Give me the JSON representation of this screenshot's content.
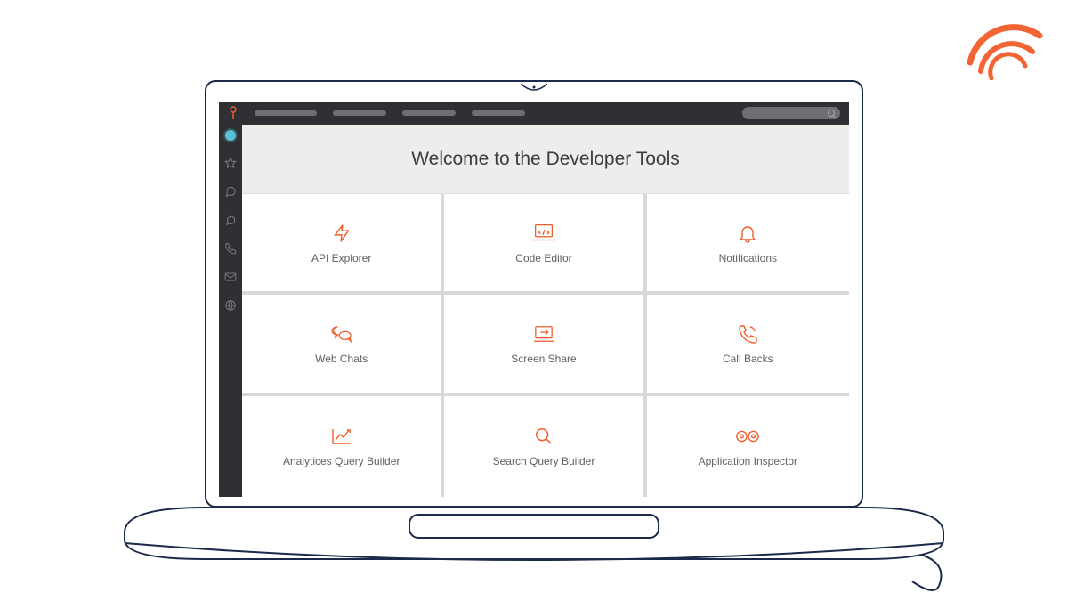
{
  "colors": {
    "accent": "#f25c2a",
    "dark": "#2f3033",
    "screen_bg": "#ffffff",
    "tile_divider": "#d9d8d6"
  },
  "header": {
    "title": "Welcome to the Developer Tools"
  },
  "sidebar": {
    "items": [
      {
        "icon": "circle-active-icon"
      },
      {
        "icon": "star-icon"
      },
      {
        "icon": "chat-bubble-icon"
      },
      {
        "icon": "chat-outline-icon"
      },
      {
        "icon": "phone-icon"
      },
      {
        "icon": "mail-icon"
      },
      {
        "icon": "globe-icon"
      }
    ]
  },
  "tiles": [
    {
      "icon": "bolt-icon",
      "label": "API Explorer"
    },
    {
      "icon": "code-laptop-icon",
      "label": "Code Editor"
    },
    {
      "icon": "bell-icon",
      "label": "Notifications"
    },
    {
      "icon": "chat-pair-icon",
      "label": "Web Chats"
    },
    {
      "icon": "screen-share-icon",
      "label": "Screen Share"
    },
    {
      "icon": "phone-call-icon",
      "label": "Call Backs"
    },
    {
      "icon": "chart-icon",
      "label": "Analytices Query Builder"
    },
    {
      "icon": "search-icon",
      "label": "Search Query Builder"
    },
    {
      "icon": "binoculars-icon",
      "label": "Application Inspector"
    }
  ]
}
